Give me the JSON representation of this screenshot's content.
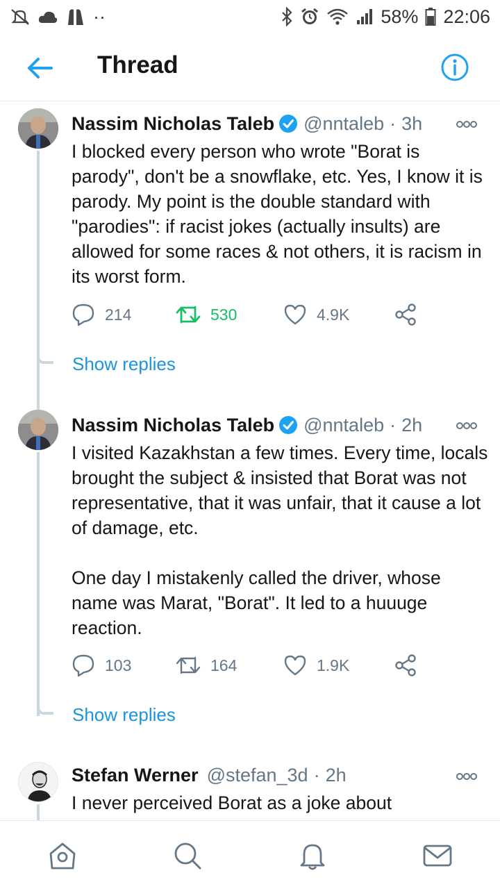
{
  "status_bar": {
    "dots": "··",
    "battery": "58%",
    "time": "22:06",
    "icons": [
      "mute-icon",
      "cloud-icon",
      "app-icon",
      "bluetooth-icon",
      "alarm-icon",
      "wifi-icon",
      "signal-icon",
      "battery-icon"
    ]
  },
  "header": {
    "title": "Thread",
    "back_icon": "arrow-left-icon",
    "info_icon": "info-icon",
    "accent": "#1da1f2"
  },
  "tweets": [
    {
      "name": "Nassim Nicholas Taleb",
      "handle": "@nntaleb",
      "separator": "·",
      "time": "3h",
      "text": "I blocked every person who wrote \"Borat is parody\", don't be a snowflake, etc. Yes, I know it is parody. My point is the double standard with \"parodies\": if racist jokes (actually insults) are allowed for some races & not others, it is racism in its worst form.",
      "replies": "214",
      "retweets": "530",
      "retweeted": true,
      "likes": "4.9K",
      "show_replies": "Show replies"
    },
    {
      "name": "Nassim Nicholas Taleb",
      "handle": "@nntaleb",
      "separator": "·",
      "time": "2h",
      "text": "I visited Kazakhstan a few times. Every time, locals brought the subject & insisted that Borat was not representative, that it was unfair, that it cause a lot of damage, etc.\n\nOne day I mistakenly called the driver, whose name was Marat, \"Borat\". It led to a huuuge reaction.",
      "replies": "103",
      "retweets": "164",
      "retweeted": false,
      "likes": "1.9K",
      "show_replies": "Show replies"
    },
    {
      "name": "Stefan Werner",
      "handle": "@stefan_3d",
      "separator": "·",
      "time": "2h",
      "text": "I never perceived Borat as a joke about"
    }
  ],
  "bottom_nav": [
    "home-icon",
    "search-icon",
    "notifications-icon",
    "messages-icon"
  ],
  "colors": {
    "retweet_active": "#17bf63",
    "link": "#1b95e0",
    "verified": "#1da1f2",
    "muted": "#657786"
  }
}
